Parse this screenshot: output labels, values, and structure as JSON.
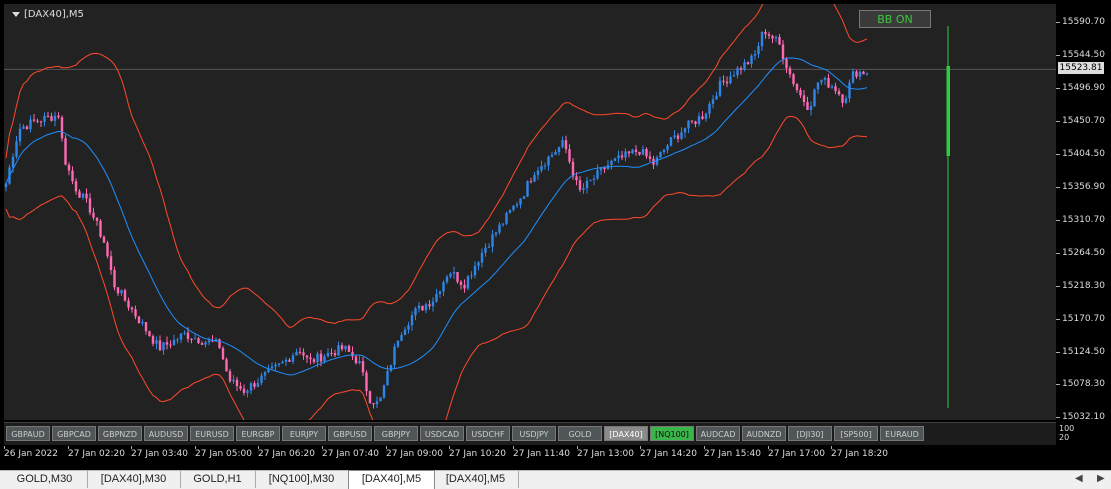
{
  "chart": {
    "title": "[DAX40],M5",
    "bb_button": "BB ON",
    "colors": {
      "background": "#222222",
      "bull": "#2f86e6",
      "bear": "#ff69b4",
      "bb_outer": "#ff4a2a",
      "bb_mid": "#1e90ff",
      "volume_bar": "#2ecc40",
      "grid_line": "#555555"
    },
    "price_axis": {
      "labels": [
        "15590.70",
        "15544.50",
        "15496.90",
        "15450.70",
        "15404.50",
        "15356.90",
        "15310.70",
        "15264.50",
        "15218.30",
        "15170.70",
        "15124.50",
        "15078.30",
        "15032.10"
      ],
      "current_price": "15523.81"
    },
    "time_axis": [
      "26 Jan 2022",
      "27 Jan 02:20",
      "27 Jan 03:40",
      "27 Jan 05:00",
      "27 Jan 06:20",
      "27 Jan 07:40",
      "27 Jan 09:00",
      "27 Jan 10:20",
      "27 Jan 11:40",
      "27 Jan 13:00",
      "27 Jan 14:20",
      "27 Jan 15:40",
      "27 Jan 17:00",
      "27 Jan 18:20"
    ],
    "sub_axis": [
      "100",
      "20"
    ]
  },
  "symbol_buttons": [
    {
      "label": "GBPAUD",
      "state": "normal"
    },
    {
      "label": "GBPCAD",
      "state": "normal"
    },
    {
      "label": "GBPNZD",
      "state": "normal"
    },
    {
      "label": "AUDUSD",
      "state": "normal"
    },
    {
      "label": "EURUSD",
      "state": "normal"
    },
    {
      "label": "EURGBP",
      "state": "normal"
    },
    {
      "label": "EURJPY",
      "state": "normal"
    },
    {
      "label": "GBPUSD",
      "state": "normal"
    },
    {
      "label": "GBPJPY",
      "state": "normal"
    },
    {
      "label": "USDCAD",
      "state": "normal"
    },
    {
      "label": "USDCHF",
      "state": "normal"
    },
    {
      "label": "USDJPY",
      "state": "normal"
    },
    {
      "label": "GOLD",
      "state": "normal"
    },
    {
      "label": "[DAX40]",
      "state": "active-gray"
    },
    {
      "label": "[NQ100]",
      "state": "active-green"
    },
    {
      "label": "AUDCAD",
      "state": "normal"
    },
    {
      "label": "AUDNZD",
      "state": "normal"
    },
    {
      "label": "[DJI30]",
      "state": "normal"
    },
    {
      "label": "[SP500]",
      "state": "normal"
    },
    {
      "label": "EURAUD",
      "state": "normal"
    }
  ],
  "tabs": [
    {
      "label": "GOLD,M30",
      "active": false
    },
    {
      "label": "[DAX40],M30",
      "active": false
    },
    {
      "label": "GOLD,H1",
      "active": false
    },
    {
      "label": "[NQ100],M30",
      "active": false
    },
    {
      "label": "[DAX40],M5",
      "active": true
    },
    {
      "label": "[DAX40],M5",
      "active": false
    }
  ],
  "icons": {
    "scroll_left": "triangle-left-icon",
    "scroll_right": "triangle-right-icon",
    "dropdown": "triangle-down-icon"
  }
}
